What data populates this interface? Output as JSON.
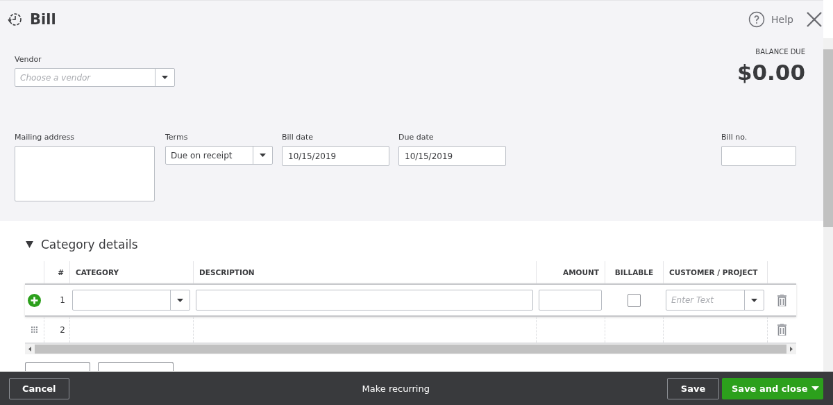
{
  "window": {
    "title": "Bill"
  },
  "help": {
    "label": "Help"
  },
  "vendor": {
    "label": "Vendor",
    "placeholder": "Choose a vendor"
  },
  "balance": {
    "label": "BALANCE DUE",
    "amount": "$0.00"
  },
  "mailing_address": {
    "label": "Mailing address"
  },
  "terms": {
    "label": "Terms",
    "value": "Due on receipt"
  },
  "bill_date": {
    "label": "Bill date",
    "value": "10/15/2019"
  },
  "due_date": {
    "label": "Due date",
    "value": "10/15/2019"
  },
  "bill_no": {
    "label": "Bill no."
  },
  "category_details": {
    "title": "Category details",
    "expanded": true,
    "columns": [
      "#",
      "CATEGORY",
      "DESCRIPTION",
      "AMOUNT",
      "BILLABLE",
      "CUSTOMER / PROJECT"
    ],
    "rows": [
      {
        "number": "1",
        "kind": "editing",
        "billable": false,
        "customer_placeholder": "Enter Text"
      },
      {
        "number": "2",
        "kind": "empty"
      }
    ]
  },
  "footer": {
    "cancel": "Cancel",
    "recurring": "Make recurring",
    "save": "Save",
    "save_close": "Save and close"
  }
}
